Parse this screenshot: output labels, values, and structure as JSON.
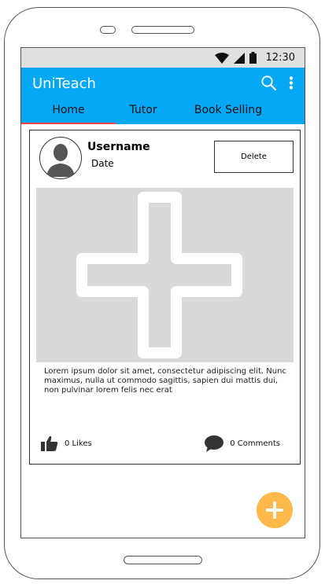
{
  "status_bar": {
    "time": "12:30",
    "icons": [
      "wifi-icon",
      "cell-signal-icon",
      "battery-icon"
    ]
  },
  "app_bar": {
    "title": "UniTeach",
    "icons": [
      "search-icon",
      "more-vertical-icon"
    ],
    "color": "#05a8f4"
  },
  "tabs": [
    {
      "label": "Home",
      "active": true
    },
    {
      "label": "Tutor",
      "active": false
    },
    {
      "label": "Book Selling",
      "active": false
    }
  ],
  "post": {
    "username": "Username",
    "date": "Date",
    "delete_label": "Delete",
    "body": "Lorem ipsum dolor sit amet, consectetur adipiscing elit. Nunc maximus, nulla ut commodo sagittis, sapien dui mattis dui, non pulvinar lorem felis nec erat",
    "likes": "0 Likes",
    "comments": "0 Comments"
  },
  "fab": {
    "icon": "plus-icon",
    "color": "#ffb84a"
  }
}
